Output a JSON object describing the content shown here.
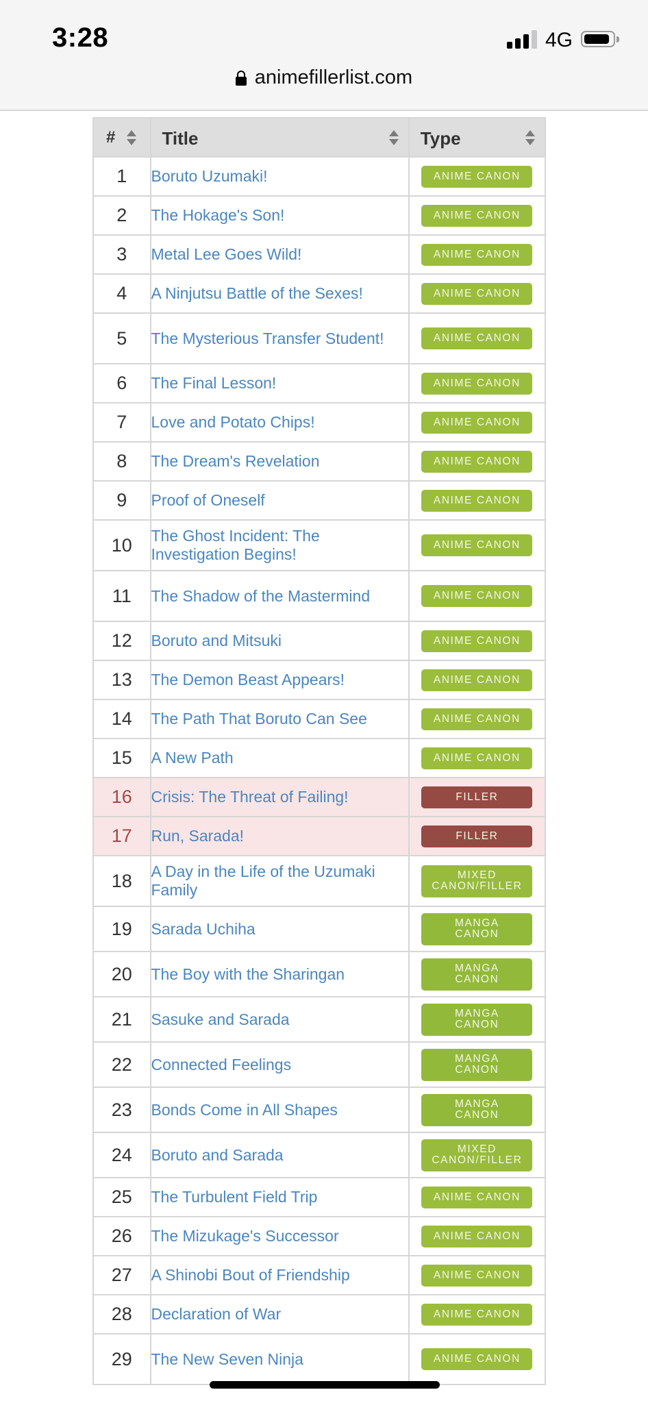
{
  "status_bar": {
    "time": "3:28",
    "network": "4G",
    "signal_bars_active": 3,
    "signal_bars_total": 4,
    "battery_level": 0.85
  },
  "browser": {
    "url": "animefillerlist.com",
    "lock_icon": "lock-icon"
  },
  "colors": {
    "anime_canon": "#9bbd3c",
    "manga_canon": "#93b93b",
    "mixed": "#98bb3d",
    "filler": "#954a43",
    "filler_row_bg": "#f9e5e6",
    "link": "#4a86bf"
  },
  "table": {
    "headers": {
      "number": "#",
      "title": "Title",
      "type": "Type"
    },
    "rows": [
      {
        "num": "1",
        "title": "Boruto Uzumaki!",
        "type": "ANIME CANON",
        "kind": "anime"
      },
      {
        "num": "2",
        "title": "The Hokage's Son!",
        "type": "ANIME CANON",
        "kind": "anime"
      },
      {
        "num": "3",
        "title": "Metal Lee Goes Wild!",
        "type": "ANIME CANON",
        "kind": "anime"
      },
      {
        "num": "4",
        "title": "A Ninjutsu Battle of the Sexes!",
        "type": "ANIME CANON",
        "kind": "anime"
      },
      {
        "num": "5",
        "title": "The Mysterious Transfer Student!",
        "type": "ANIME CANON",
        "kind": "anime"
      },
      {
        "num": "6",
        "title": "The Final Lesson!",
        "type": "ANIME CANON",
        "kind": "anime"
      },
      {
        "num": "7",
        "title": "Love and Potato Chips!",
        "type": "ANIME CANON",
        "kind": "anime"
      },
      {
        "num": "8",
        "title": "The Dream's Revelation",
        "type": "ANIME CANON",
        "kind": "anime"
      },
      {
        "num": "9",
        "title": "Proof of Oneself",
        "type": "ANIME CANON",
        "kind": "anime"
      },
      {
        "num": "10",
        "title": "The Ghost Incident: The Investigation Begins!",
        "type": "ANIME CANON",
        "kind": "anime"
      },
      {
        "num": "11",
        "title": "The Shadow of the Mastermind",
        "type": "ANIME CANON",
        "kind": "anime"
      },
      {
        "num": "12",
        "title": "Boruto and Mitsuki",
        "type": "ANIME CANON",
        "kind": "anime"
      },
      {
        "num": "13",
        "title": "The Demon Beast Appears!",
        "type": "ANIME CANON",
        "kind": "anime"
      },
      {
        "num": "14",
        "title": "The Path That Boruto Can See",
        "type": "ANIME CANON",
        "kind": "anime"
      },
      {
        "num": "15",
        "title": "A New Path",
        "type": "ANIME CANON",
        "kind": "anime"
      },
      {
        "num": "16",
        "title": "Crisis: The Threat of Failing!",
        "type": "FILLER",
        "kind": "filler"
      },
      {
        "num": "17",
        "title": "Run, Sarada!",
        "type": "FILLER",
        "kind": "filler"
      },
      {
        "num": "18",
        "title": "A Day in the Life of the Uzumaki Family",
        "type": "MIXED CANON/FILLER",
        "kind": "mixed"
      },
      {
        "num": "19",
        "title": "Sarada Uchiha",
        "type": "MANGA CANON",
        "kind": "manga"
      },
      {
        "num": "20",
        "title": "The Boy with the Sharingan",
        "type": "MANGA CANON",
        "kind": "manga"
      },
      {
        "num": "21",
        "title": "Sasuke and Sarada",
        "type": "MANGA CANON",
        "kind": "manga"
      },
      {
        "num": "22",
        "title": "Connected Feelings",
        "type": "MANGA CANON",
        "kind": "manga"
      },
      {
        "num": "23",
        "title": "Bonds Come in All Shapes",
        "type": "MANGA CANON",
        "kind": "manga"
      },
      {
        "num": "24",
        "title": "Boruto and Sarada",
        "type": "MIXED CANON/FILLER",
        "kind": "mixed"
      },
      {
        "num": "25",
        "title": "The Turbulent Field Trip",
        "type": "ANIME CANON",
        "kind": "anime"
      },
      {
        "num": "26",
        "title": "The Mizukage's Successor",
        "type": "ANIME CANON",
        "kind": "anime"
      },
      {
        "num": "27",
        "title": "A Shinobi Bout of Friendship",
        "type": "ANIME CANON",
        "kind": "anime"
      },
      {
        "num": "28",
        "title": "Declaration of War",
        "type": "ANIME CANON",
        "kind": "anime"
      },
      {
        "num": "29",
        "title": "The New Seven Ninja",
        "type": "ANIME CANON",
        "kind": "anime"
      }
    ]
  }
}
